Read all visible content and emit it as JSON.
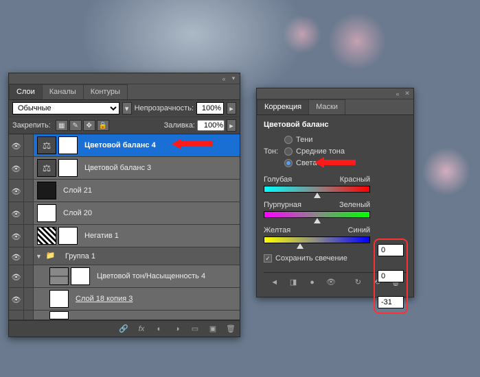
{
  "layersPanel": {
    "tabs": [
      "Слои",
      "Каналы",
      "Контуры"
    ],
    "activeTab": 0,
    "blendMode": "Обычные",
    "opacityLabel": "Непрозрачность:",
    "opacityValue": "100%",
    "lockLabel": "Закрепить:",
    "fillLabel": "Заливка:",
    "fillValue": "100%",
    "layers": [
      {
        "name": "Цветовой баланс 4",
        "type": "adj",
        "icon": "⚖",
        "selected": true
      },
      {
        "name": "Цветовой баланс 3",
        "type": "adj",
        "icon": "⚖"
      },
      {
        "name": "Слой 21",
        "type": "dark"
      },
      {
        "name": "Слой 20",
        "type": "plain"
      },
      {
        "name": "Негатив 1",
        "type": "neg"
      },
      {
        "name": "Группа 1",
        "type": "group"
      },
      {
        "name": "Цветовой тон/Насыщенность 4",
        "type": "hue",
        "nested": true
      },
      {
        "name": "Слой 18 копия 3",
        "type": "plain",
        "nested": true,
        "underline": true
      }
    ]
  },
  "adjPanel": {
    "tabs": [
      "Коррекция",
      "Маски"
    ],
    "activeTab": 0,
    "title": "Цветовой баланс",
    "toneLabel": "Тон:",
    "tones": [
      {
        "label": "Тени",
        "checked": false
      },
      {
        "label": "Средние тона",
        "checked": false
      },
      {
        "label": "Света",
        "checked": true
      }
    ],
    "sliders": [
      {
        "left": "Голубая",
        "right": "Красный",
        "grad": "g-cr",
        "pos": 50
      },
      {
        "left": "Пурпурная",
        "right": "Зеленый",
        "grad": "g-mg",
        "pos": 50
      },
      {
        "left": "Желтая",
        "right": "Синий",
        "grad": "g-yb",
        "pos": 34
      }
    ],
    "values": [
      "0",
      "0",
      "-31"
    ],
    "preserveLabel": "Сохранить свечение",
    "preserveChecked": true
  },
  "chart_data": {
    "type": "table",
    "title": "Цветовой баланс — Света",
    "categories": [
      "Голубая/Красный",
      "Пурпурная/Зеленый",
      "Желтая/Синий"
    ],
    "values": [
      0,
      0,
      -31
    ],
    "range": [
      -100,
      100
    ]
  }
}
